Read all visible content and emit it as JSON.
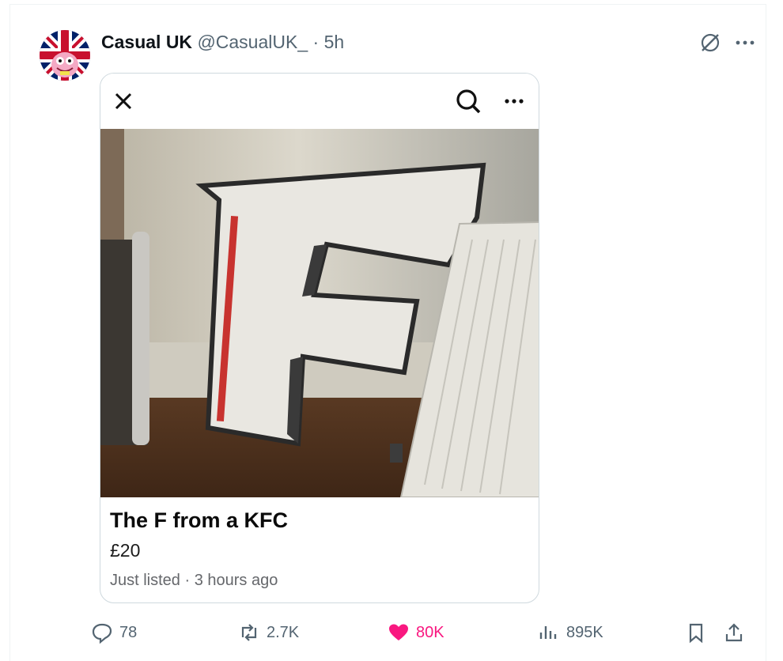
{
  "tweet": {
    "author_name": "Casual UK",
    "author_handle": "@CasualUK_",
    "separator": "·",
    "time": "5h",
    "icons": {
      "avatar": "union-jack-avatar",
      "grok": "grok-icon",
      "more": "more-horizontal-icon"
    }
  },
  "card": {
    "icons": {
      "close": "close-icon",
      "search": "search-icon",
      "more": "more-horizontal-icon"
    },
    "listing": {
      "title": "The F from a KFC",
      "price": "£20",
      "meta": "Just listed · 3 hours ago"
    }
  },
  "actions": {
    "replies": "78",
    "reposts": "2.7K",
    "likes": "80K",
    "views": "895K"
  },
  "colors": {
    "like": "#f91880",
    "muted": "#536471",
    "border": "#cfd9de"
  }
}
